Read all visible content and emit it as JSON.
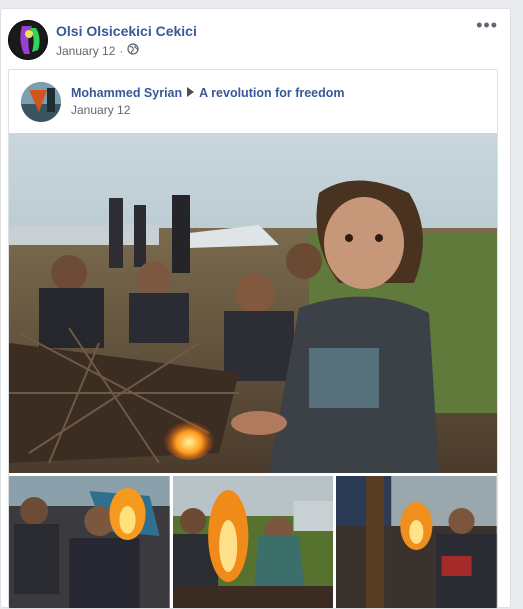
{
  "post": {
    "author": "Olsi Olsicekici Cekici",
    "date": "January 12",
    "dot": "·",
    "privacy_icon": "globe-icon",
    "more_label": "•••"
  },
  "shared_post": {
    "author": "Mohammed Syrian",
    "arrow_icon": "caret-right-icon",
    "group": "A revolution for freedom",
    "date": "January 12"
  },
  "colors": {
    "link": "#385898",
    "meta": "#616770",
    "background": "#e9ebee"
  }
}
